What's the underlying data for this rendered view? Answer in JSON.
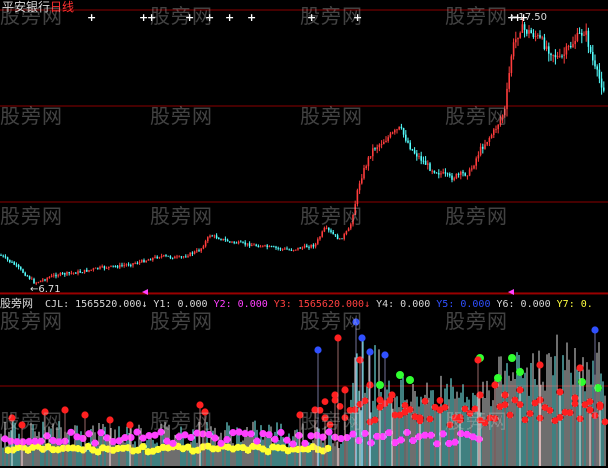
{
  "header": {
    "symbol": "平安银行",
    "period": "日线"
  },
  "price_chart": {
    "high_marker": "17.50",
    "low_marker": "6.71",
    "colors": {
      "up": "#ff3c3c",
      "down": "#54ffff",
      "grid": "#8b0000",
      "signal": "#ffffff"
    }
  },
  "indicator": {
    "name": "股旁网",
    "values": [
      {
        "label": "CJL:",
        "value": "1565520.000",
        "arrow": "↓",
        "color": "#d8d8d8"
      },
      {
        "label": "Y1:",
        "value": "0.000",
        "arrow": "",
        "color": "#d8d8d8"
      },
      {
        "label": "Y2:",
        "value": "0.000",
        "arrow": "",
        "color": "#ff40ff"
      },
      {
        "label": "Y3:",
        "value": "1565620.000",
        "arrow": "↓",
        "color": "#ff4040"
      },
      {
        "label": "Y4:",
        "value": "0.000",
        "arrow": "",
        "color": "#d8d8d8"
      },
      {
        "label": "Y5:",
        "value": "0.000",
        "arrow": "",
        "color": "#3050ff"
      },
      {
        "label": "Y6:",
        "value": "0.000",
        "arrow": "",
        "color": "#d8d8d8"
      },
      {
        "label": "Y7:",
        "value": "0.",
        "arrow": "",
        "color": "#ffff40"
      }
    ]
  },
  "watermark": "股旁网"
}
